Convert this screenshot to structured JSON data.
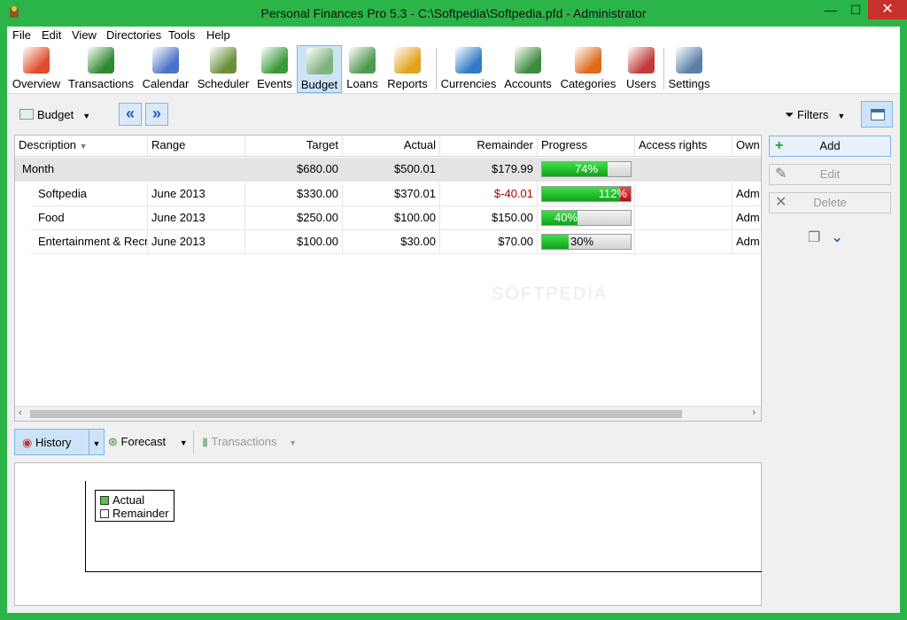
{
  "window": {
    "title": "Personal Finances Pro 5.3 - C:\\Softpedia\\Softpedia.pfd - Administrator",
    "minimize": "—",
    "maximize": "☐",
    "close": "✕"
  },
  "menu": [
    "File",
    "Edit",
    "View",
    "Directories",
    "Tools",
    "Help"
  ],
  "toolbar": [
    {
      "label": "Overview",
      "icon": "overview-icon",
      "color": "#e04b2b"
    },
    {
      "label": "Transactions",
      "icon": "transactions-icon",
      "color": "#2e8a2e"
    },
    {
      "label": "Calendar",
      "icon": "calendar-icon",
      "color": "#4a73c9"
    },
    {
      "label": "Scheduler",
      "icon": "scheduler-icon",
      "color": "#6a8f3a"
    },
    {
      "label": "Events",
      "icon": "events-icon",
      "color": "#3a9a3a"
    },
    {
      "label": "Budget",
      "icon": "budget-icon",
      "color": "#7fb37f"
    },
    {
      "label": "Loans",
      "icon": "loans-icon",
      "color": "#4f9a4f"
    },
    {
      "label": "Reports",
      "icon": "reports-icon",
      "color": "#e2a21b"
    },
    {
      "label": "Currencies",
      "icon": "currencies-icon",
      "color": "#2f7bc8"
    },
    {
      "label": "Accounts",
      "icon": "accounts-icon",
      "color": "#3d8c3d"
    },
    {
      "label": "Categories",
      "icon": "categories-icon",
      "color": "#e06a1a"
    },
    {
      "label": "Users",
      "icon": "users-icon",
      "color": "#c23a3a"
    },
    {
      "label": "Settings",
      "icon": "settings-icon",
      "color": "#5a7fa8"
    }
  ],
  "subbar": {
    "budget_label": "Budget",
    "prev": "«",
    "next": "»",
    "filters_label": "Filters"
  },
  "grid": {
    "columns": [
      "Description",
      "Range",
      "Target",
      "Actual",
      "Remainder",
      "Progress",
      "Access rights",
      "Own"
    ],
    "group": {
      "description": "Month",
      "target": "$680.00",
      "actual": "$500.01",
      "remainder": "$179.99",
      "progress_pct": 74,
      "progress_label": "74%"
    },
    "rows": [
      {
        "description": "Softpedia",
        "range": "June 2013",
        "target": "$330.00",
        "actual": "$370.01",
        "remainder": "$-40.01",
        "progress_pct": 112,
        "progress_label": "112%",
        "owner": "Adm"
      },
      {
        "description": "Food",
        "range": "June 2013",
        "target": "$250.00",
        "actual": "$100.00",
        "remainder": "$150.00",
        "progress_pct": 40,
        "progress_label": "40%",
        "owner": "Adm"
      },
      {
        "description": "Entertainment & Recr",
        "range": "June 2013",
        "target": "$100.00",
        "actual": "$30.00",
        "remainder": "$70.00",
        "progress_pct": 30,
        "progress_label": "30%",
        "owner": "Adm"
      }
    ]
  },
  "side": {
    "add": "Add",
    "edit": "Edit",
    "delete": "Delete"
  },
  "tabs": {
    "history": "History",
    "forecast": "Forecast",
    "transactions": "Transactions"
  },
  "legend": {
    "actual": "Actual",
    "remainder": "Remainder",
    "actual_color": "#5bbf4a"
  }
}
